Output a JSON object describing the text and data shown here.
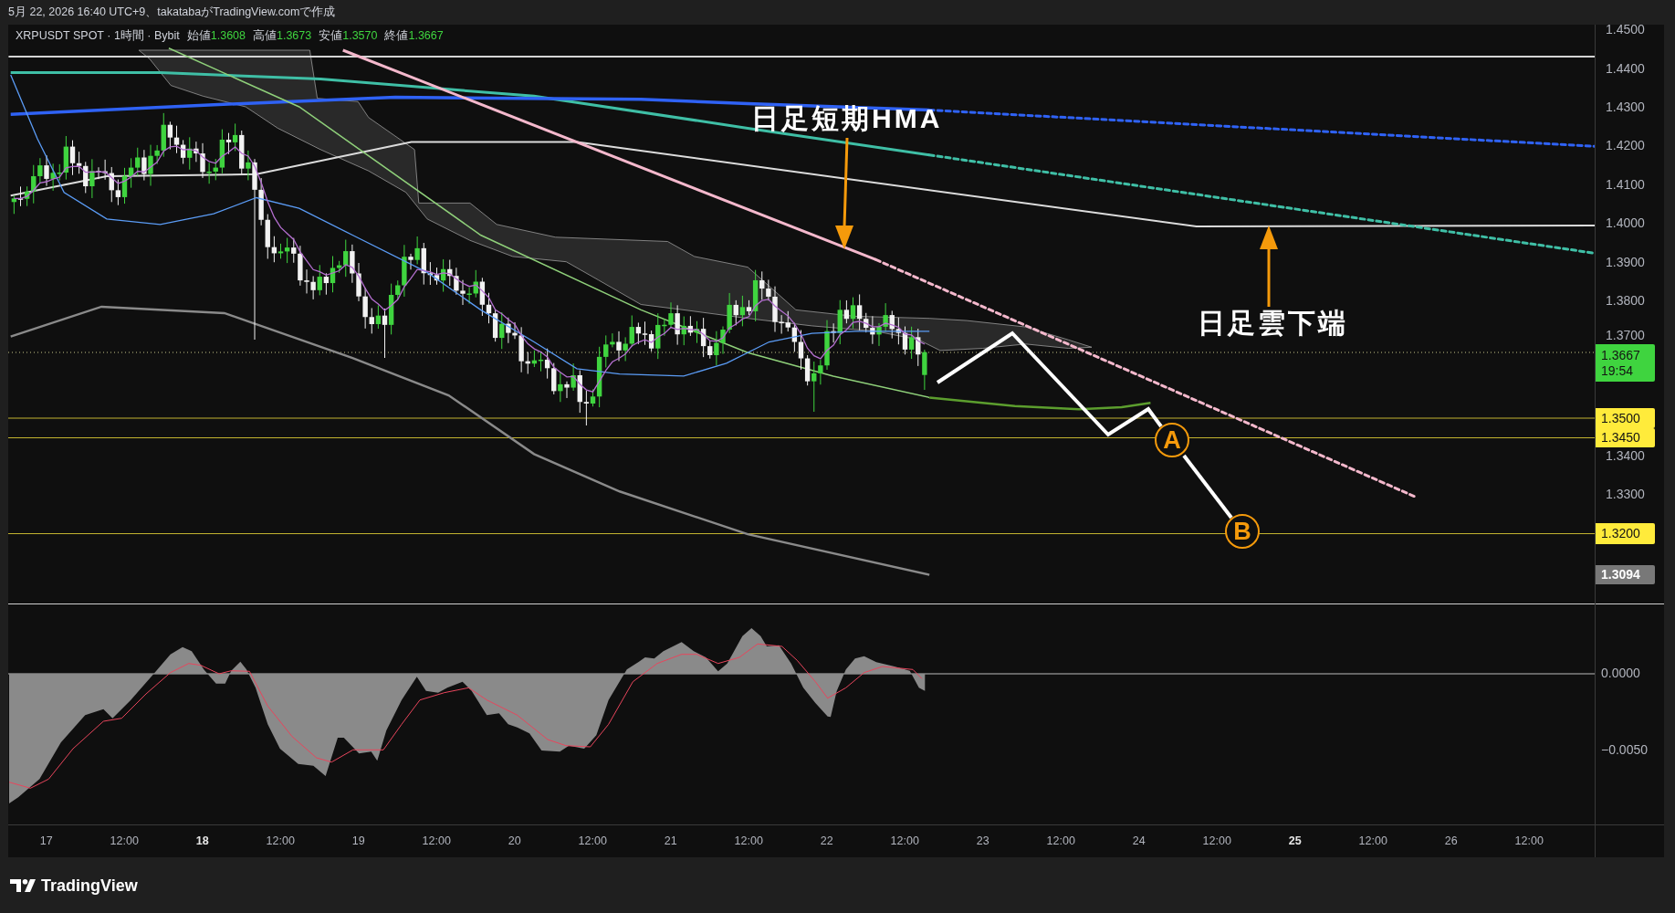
{
  "header": {
    "text": "5月 22, 2026 16:40 UTC+9、takatabaがTradingView.comで作成"
  },
  "legend": {
    "symbol": "XRPUSDT SPOT · 1時間 · Bybit",
    "ohlc": [
      {
        "label": "始値",
        "value": "1.3608"
      },
      {
        "label": "高値",
        "value": "1.3673"
      },
      {
        "label": "安値",
        "value": "1.3570"
      },
      {
        "label": "終値",
        "value": "1.3667"
      }
    ]
  },
  "annotations": [
    {
      "kind": "arrow_down",
      "text": "日足短期HMA"
    },
    {
      "kind": "arrow_up",
      "text": "日足雲下端"
    }
  ],
  "wave_labels": [
    {
      "text": "A"
    },
    {
      "text": "B"
    }
  ],
  "price_axis": {
    "ticks": [
      "1.4500",
      "1.4400",
      "1.4300",
      "1.4200",
      "1.4100",
      "1.4000",
      "1.3900",
      "1.3800",
      "1.3700",
      "1.3400",
      "1.3300"
    ],
    "markers": [
      {
        "kind": "last_price",
        "price": "1.3667",
        "countdown": "19:54",
        "color": "#3fd43f"
      },
      {
        "kind": "level",
        "price": "1.3500",
        "color": "#ffeb3b"
      },
      {
        "kind": "level",
        "price": "1.3450",
        "color": "#ffeb3b"
      },
      {
        "kind": "level",
        "price": "1.3200",
        "color": "#ffeb3b"
      },
      {
        "kind": "value",
        "price": "1.3094",
        "color": "#787878"
      }
    ]
  },
  "indicator_pane": {
    "axis_ticks": [
      "0.0000",
      "−0.0050"
    ]
  },
  "time_axis": {
    "ticks": [
      {
        "label": "17",
        "emphasized": false
      },
      {
        "label": "12:00",
        "emphasized": false
      },
      {
        "label": "18",
        "emphasized": true
      },
      {
        "label": "12:00",
        "emphasized": false
      },
      {
        "label": "19",
        "emphasized": false
      },
      {
        "label": "12:00",
        "emphasized": false
      },
      {
        "label": "20",
        "emphasized": false
      },
      {
        "label": "12:00",
        "emphasized": false
      },
      {
        "label": "21",
        "emphasized": false
      },
      {
        "label": "12:00",
        "emphasized": false
      },
      {
        "label": "22",
        "emphasized": false
      },
      {
        "label": "12:00",
        "emphasized": false
      },
      {
        "label": "23",
        "emphasized": false
      },
      {
        "label": "12:00",
        "emphasized": false
      },
      {
        "label": "24",
        "emphasized": false
      },
      {
        "label": "12:00",
        "emphasized": false
      },
      {
        "label": "25",
        "emphasized": true
      },
      {
        "label": "12:00",
        "emphasized": false
      },
      {
        "label": "26",
        "emphasized": false
      },
      {
        "label": "12:00",
        "emphasized": false
      }
    ]
  },
  "footer": {
    "logo_text": "TradingView"
  }
}
